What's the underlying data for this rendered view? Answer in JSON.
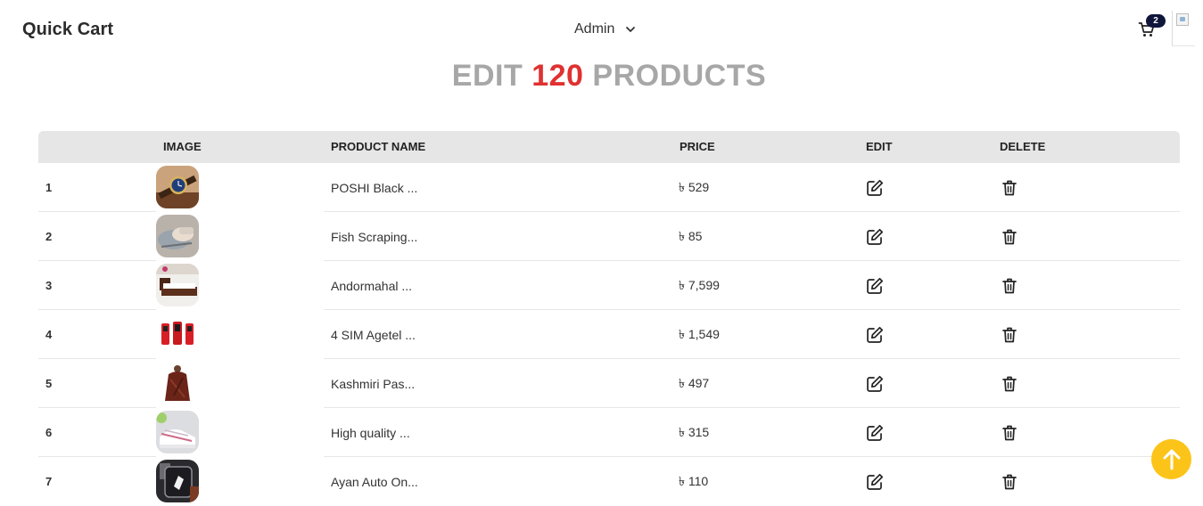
{
  "header": {
    "brand": "Quick Cart",
    "user_menu_label": "Admin",
    "cart_count": "2"
  },
  "page": {
    "title_prefix": "EDIT",
    "title_count": "120",
    "title_suffix": "PRODUCTS"
  },
  "table": {
    "columns": {
      "image": "IMAGE",
      "name": "PRODUCT NAME",
      "price": "PRICE",
      "edit": "EDIT",
      "delete": "DELETE"
    },
    "rows": [
      {
        "index": "1",
        "name": "POSHI Black ...",
        "price": "৳ 529",
        "image": "watch"
      },
      {
        "index": "2",
        "name": "Fish Scraping...",
        "price": "৳ 85",
        "image": "fish-scraper"
      },
      {
        "index": "3",
        "name": "Andormahal ...",
        "price": "৳ 7,599",
        "image": "bed"
      },
      {
        "index": "4",
        "name": "4 SIM Agetel ...",
        "price": "৳ 1,549",
        "image": "phone"
      },
      {
        "index": "5",
        "name": "Kashmiri Pas...",
        "price": "৳ 497",
        "image": "shawl"
      },
      {
        "index": "6",
        "name": "High quality ...",
        "price": "৳ 315",
        "image": "sneakers"
      },
      {
        "index": "7",
        "name": "Ayan Auto On...",
        "price": "৳ 110",
        "image": "smart-light"
      }
    ]
  },
  "icons": {
    "cart": "cart-icon",
    "chevron": "chevron-down-icon",
    "edit": "edit-icon",
    "delete": "trash-icon",
    "scroll_top": "arrow-up-icon"
  },
  "colors": {
    "title_gray": "#a7a7a7",
    "title_accent": "#e03131",
    "header_row": "#e6e6e6",
    "badge": "#10163a",
    "scroll_button": "#fcc419"
  }
}
